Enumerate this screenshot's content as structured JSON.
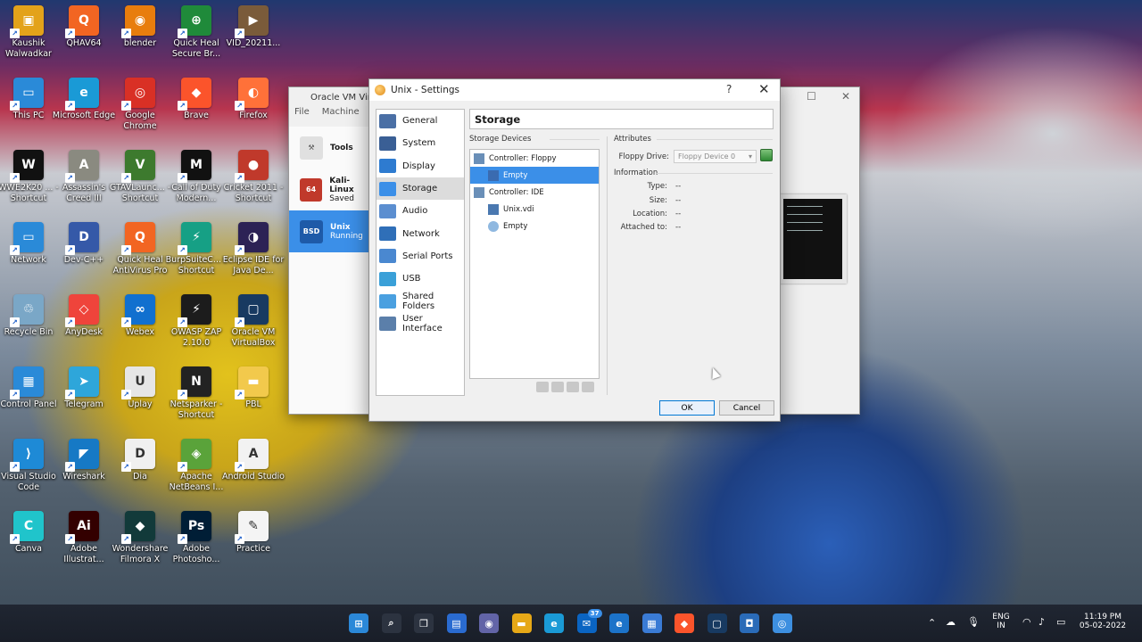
{
  "desktop": {
    "icons": [
      {
        "label": "Kaushik Walwadkar",
        "color": "#e3a21a",
        "glyph": "▣"
      },
      {
        "label": "QHAV64",
        "color": "#f26522",
        "glyph": "Q"
      },
      {
        "label": "blender",
        "color": "#e87d0d",
        "glyph": "◉"
      },
      {
        "label": "Quick Heal Secure Br...",
        "color": "#1f8a3a",
        "glyph": "⊕"
      },
      {
        "label": "VID_20211...",
        "color": "#7a5b3a",
        "glyph": "▶"
      },
      {
        "label": "This PC",
        "color": "#2a8ad8",
        "glyph": "▭"
      },
      {
        "label": "Microsoft Edge",
        "color": "#1a9ad6",
        "glyph": "e"
      },
      {
        "label": "Google Chrome",
        "color": "#d93025",
        "glyph": "◎"
      },
      {
        "label": "Brave",
        "color": "#fb542b",
        "glyph": "◆"
      },
      {
        "label": "Firefox",
        "color": "#ff7139",
        "glyph": "◐"
      },
      {
        "label": "WWE2K20 ... - Shortcut",
        "color": "#111111",
        "glyph": "W"
      },
      {
        "label": "Assassin's Creed III",
        "color": "#8a8a80",
        "glyph": "A"
      },
      {
        "label": "GTAVLaunc... - Shortcut",
        "color": "#3d7a2e",
        "glyph": "V"
      },
      {
        "label": "Call of Duty Modern...",
        "color": "#111111",
        "glyph": "M"
      },
      {
        "label": "Cricket 2011 - Shortcut",
        "color": "#c0392b",
        "glyph": "●"
      },
      {
        "label": "Network",
        "color": "#2a8ad8",
        "glyph": "▭"
      },
      {
        "label": "Dev-C++",
        "color": "#3559a8",
        "glyph": "D"
      },
      {
        "label": "Quick Heal AntiVirus Pro",
        "color": "#f26522",
        "glyph": "Q"
      },
      {
        "label": "BurpSuiteC... - Shortcut",
        "color": "#16a085",
        "glyph": "⚡"
      },
      {
        "label": "Eclipse IDE for Java De...",
        "color": "#2c2255",
        "glyph": "◑"
      },
      {
        "label": "Recycle Bin",
        "color": "#7aa7c7",
        "glyph": "♲"
      },
      {
        "label": "AnyDesk",
        "color": "#ef443b",
        "glyph": "◇"
      },
      {
        "label": "Webex",
        "color": "#1170cf",
        "glyph": "∞"
      },
      {
        "label": "OWASP ZAP 2.10.0",
        "color": "#1c1c1c",
        "glyph": "⚡"
      },
      {
        "label": "Oracle VM VirtualBox",
        "color": "#183a61",
        "glyph": "▢"
      },
      {
        "label": "Control Panel",
        "color": "#2a8ad8",
        "glyph": "▦"
      },
      {
        "label": "Telegram",
        "color": "#2ea6da",
        "glyph": "➤"
      },
      {
        "label": "Uplay",
        "color": "#e6e6e6",
        "glyph": "U"
      },
      {
        "label": "Netsparker - Shortcut",
        "color": "#222222",
        "glyph": "N"
      },
      {
        "label": "PBL",
        "color": "#f2c94c",
        "glyph": "▬"
      },
      {
        "label": "Visual Studio Code",
        "color": "#1e8ad6",
        "glyph": "⟩"
      },
      {
        "label": "Wireshark",
        "color": "#1679c5",
        "glyph": "◤"
      },
      {
        "label": "Dia",
        "color": "#f0f0f0",
        "glyph": "D"
      },
      {
        "label": "Apache NetBeans I...",
        "color": "#5aa33a",
        "glyph": "◈"
      },
      {
        "label": "Android Studio",
        "color": "#f2f2f2",
        "glyph": "A"
      },
      {
        "label": "Canva",
        "color": "#20c4cb",
        "glyph": "C"
      },
      {
        "label": "Adobe Illustrat...",
        "color": "#330000",
        "glyph": "Ai"
      },
      {
        "label": "Wondershare Filmora X",
        "color": "#123a3a",
        "glyph": "◆"
      },
      {
        "label": "Adobe Photosho...",
        "color": "#001e36",
        "glyph": "Ps"
      },
      {
        "label": "Practice",
        "color": "#f4f4f4",
        "glyph": "✎"
      }
    ]
  },
  "manager": {
    "title": "Oracle VM Virtu",
    "menu": [
      "File",
      "Machine",
      "H"
    ],
    "tools_label": "Tools",
    "vms": [
      {
        "name": "Kali-Linux",
        "state": "Saved",
        "color": "#c0392b",
        "glyph": "64"
      },
      {
        "name": "Unix",
        "state": "Running",
        "color": "#2a6bb8",
        "glyph": "BSD"
      }
    ],
    "maximize": "☐",
    "close": "✕"
  },
  "dialog": {
    "title": "Unix - Settings",
    "help": "?",
    "close": "✕",
    "section_title": "Storage",
    "nav": [
      {
        "label": "General",
        "color": "#4a6fa5"
      },
      {
        "label": "System",
        "color": "#3a5f95"
      },
      {
        "label": "Display",
        "color": "#2e7bd0"
      },
      {
        "label": "Storage",
        "color": "#3b8fe8"
      },
      {
        "label": "Audio",
        "color": "#5b8ed0"
      },
      {
        "label": "Network",
        "color": "#2f6fb8"
      },
      {
        "label": "Serial Ports",
        "color": "#4a88d0"
      },
      {
        "label": "USB",
        "color": "#3aa0d8"
      },
      {
        "label": "Shared Folders",
        "color": "#4aa0e0"
      },
      {
        "label": "User Interface",
        "color": "#5b7faa"
      }
    ],
    "storage_devices_label": "Storage Devices",
    "tree": [
      {
        "label": "Controller: Floppy",
        "level": 0,
        "icon": "controller"
      },
      {
        "label": "Empty",
        "level": 1,
        "icon": "floppy",
        "selected": true
      },
      {
        "label": "Controller: IDE",
        "level": 0,
        "icon": "controller"
      },
      {
        "label": "Unix.vdi",
        "level": 1,
        "icon": "disk"
      },
      {
        "label": "Empty",
        "level": 1,
        "icon": "cd"
      }
    ],
    "attributes_label": "Attributes",
    "floppy_drive_label": "Floppy Drive:",
    "floppy_drive_value": "Floppy Device 0",
    "information_label": "Information",
    "info": [
      {
        "key": "Type:",
        "value": "--"
      },
      {
        "key": "Size:",
        "value": "--"
      },
      {
        "key": "Location:",
        "value": "--"
      },
      {
        "key": "Attached to:",
        "value": "--"
      }
    ],
    "ok": "OK",
    "cancel": "Cancel"
  },
  "taskbar": {
    "apps": [
      {
        "name": "start",
        "color": "#2b88d8",
        "glyph": "⊞"
      },
      {
        "name": "search",
        "color": "#2c3340",
        "glyph": "⌕"
      },
      {
        "name": "task-view",
        "color": "#2c3340",
        "glyph": "❐"
      },
      {
        "name": "widgets",
        "color": "#2a6bd0",
        "glyph": "▤"
      },
      {
        "name": "chat",
        "color": "#6264a7",
        "glyph": "◉"
      },
      {
        "name": "file-explorer",
        "color": "#e6a817",
        "glyph": "▬"
      },
      {
        "name": "edge",
        "color": "#1a9ad6",
        "glyph": "e"
      },
      {
        "name": "mail",
        "color": "#0a64c2",
        "glyph": "✉"
      },
      {
        "name": "internet-explorer",
        "color": "#1c73c9",
        "glyph": "e"
      },
      {
        "name": "store",
        "color": "#3a7bd5",
        "glyph": "▦"
      },
      {
        "name": "brave",
        "color": "#fb542b",
        "glyph": "◆"
      },
      {
        "name": "virtualbox",
        "color": "#183a61",
        "glyph": "▢"
      },
      {
        "name": "app-notify",
        "color": "#2a6bb8",
        "glyph": "◘"
      },
      {
        "name": "app-compass",
        "color": "#3d8fe0",
        "glyph": "◎"
      }
    ],
    "mail_badge": "37",
    "lang_top": "ENG",
    "lang_bottom": "IN",
    "time": "11:19 PM",
    "date": "05-02-2022"
  }
}
